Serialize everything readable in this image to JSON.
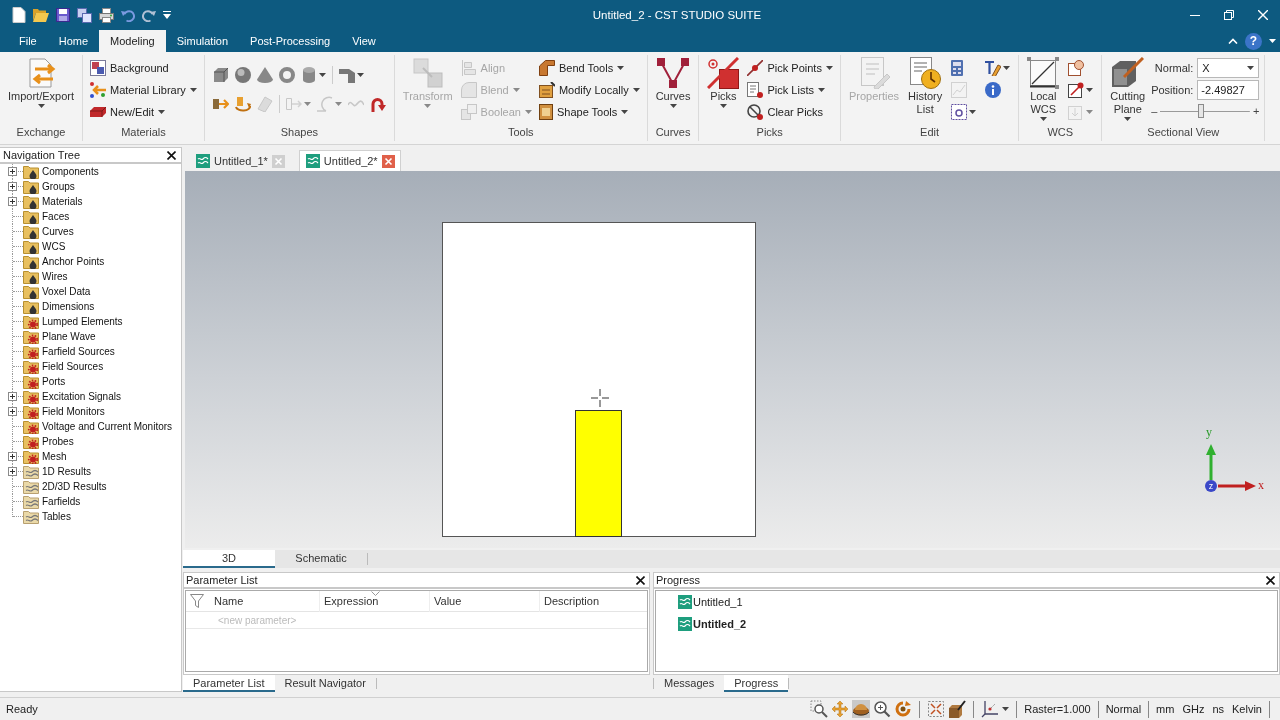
{
  "window": {
    "title": "Untitled_2 - CST STUDIO SUITE"
  },
  "ribbon_tabs": [
    {
      "label": "File",
      "selected": false
    },
    {
      "label": "Home",
      "selected": false
    },
    {
      "label": "Modeling",
      "selected": true
    },
    {
      "label": "Simulation",
      "selected": false
    },
    {
      "label": "Post-Processing",
      "selected": false
    },
    {
      "label": "View",
      "selected": false
    }
  ],
  "help": {
    "label": "?"
  },
  "ribbon_groups": [
    {
      "title": "Exchange",
      "columns": [
        {
          "kind": "large",
          "label": "Import/Export",
          "dropdown": true,
          "disabled": false
        }
      ]
    },
    {
      "title": "Materials",
      "columns": [
        {
          "kind": "stack",
          "items": [
            {
              "kind": "button",
              "label": "Background",
              "dropdown": false,
              "disabled": false
            },
            {
              "kind": "button",
              "label": "Material Library",
              "dropdown": true,
              "disabled": false
            },
            {
              "kind": "button",
              "label": "New/Edit",
              "dropdown": true,
              "disabled": false
            }
          ]
        }
      ]
    },
    {
      "title": "Shapes",
      "columns": [
        {
          "kind": "rows",
          "rows": [
            [
              {
                "kind": "icon",
                "dropdown": false,
                "disabled": false
              },
              {
                "kind": "icon",
                "dropdown": false,
                "disabled": false
              },
              {
                "kind": "icon",
                "dropdown": false,
                "disabled": false
              },
              {
                "kind": "icon",
                "dropdown": false,
                "disabled": false
              },
              {
                "kind": "icon",
                "dropdown": true,
                "disabled": false
              },
              {
                "kind": "separator"
              },
              {
                "kind": "icon",
                "dropdown": true,
                "disabled": false
              }
            ],
            [
              {
                "kind": "icon",
                "dropdown": false,
                "disabled": false
              },
              {
                "kind": "icon",
                "dropdown": false,
                "disabled": false
              },
              {
                "kind": "icon",
                "dropdown": false,
                "disabled": true
              },
              {
                "kind": "separator"
              },
              {
                "kind": "icon",
                "dropdown": true,
                "disabled": true
              },
              {
                "kind": "icon",
                "dropdown": true,
                "disabled": true
              },
              {
                "kind": "icon",
                "dropdown": false,
                "disabled": true
              },
              {
                "kind": "icon",
                "dropdown": false,
                "disabled": false
              }
            ]
          ]
        }
      ]
    },
    {
      "title": "Tools",
      "columns": [
        {
          "kind": "large",
          "label": "Transform",
          "dropdown": true,
          "disabled": true
        },
        {
          "kind": "stack",
          "items": [
            {
              "kind": "button",
              "label": "Align",
              "dropdown": false,
              "disabled": true
            },
            {
              "kind": "button",
              "label": "Blend",
              "dropdown": true,
              "disabled": true
            },
            {
              "kind": "button",
              "label": "Boolean",
              "dropdown": true,
              "disabled": true
            }
          ]
        },
        {
          "kind": "stack",
          "items": [
            {
              "kind": "button",
              "label": "Bend Tools",
              "dropdown": true,
              "disabled": false
            },
            {
              "kind": "button",
              "label": "Modify Locally",
              "dropdown": true,
              "disabled": false
            },
            {
              "kind": "button",
              "label": "Shape Tools",
              "dropdown": true,
              "disabled": false
            }
          ]
        }
      ]
    },
    {
      "title": "Curves",
      "columns": [
        {
          "kind": "large",
          "label": "Curves",
          "dropdown": true,
          "disabled": false
        }
      ]
    },
    {
      "title": "Picks",
      "columns": [
        {
          "kind": "large",
          "label": "Picks",
          "dropdown": true,
          "disabled": false
        },
        {
          "kind": "stack",
          "items": [
            {
              "kind": "button",
              "label": "Pick Points",
              "dropdown": true,
              "disabled": false
            },
            {
              "kind": "button",
              "label": "Pick Lists",
              "dropdown": true,
              "disabled": false
            },
            {
              "kind": "button",
              "label": "Clear Picks",
              "dropdown": false,
              "disabled": false
            }
          ]
        }
      ]
    },
    {
      "title": "Edit",
      "columns": [
        {
          "kind": "large",
          "label": "Properties",
          "dropdown": false,
          "disabled": true
        },
        {
          "kind": "large",
          "label": "History List",
          "dropdown": false,
          "disabled": false
        },
        {
          "kind": "stack",
          "items": [
            {
              "kind": "icon",
              "dropdown": false,
              "disabled": false
            },
            {
              "kind": "icon",
              "dropdown": false,
              "disabled": true
            },
            {
              "kind": "icon",
              "dropdown": true,
              "disabled": false
            }
          ]
        },
        {
          "kind": "stack",
          "items": [
            {
              "kind": "icon",
              "dropdown": true,
              "disabled": false
            },
            {
              "kind": "icon",
              "dropdown": false,
              "disabled": false
            }
          ]
        }
      ]
    },
    {
      "title": "WCS",
      "columns": [
        {
          "kind": "large",
          "label": "Local WCS",
          "dropdown": true,
          "disabled": false
        },
        {
          "kind": "stack",
          "items": [
            {
              "kind": "icon",
              "dropdown": false,
              "disabled": false
            },
            {
              "kind": "icon",
              "dropdown": true,
              "disabled": false
            },
            {
              "kind": "icon",
              "dropdown": true,
              "disabled": true
            }
          ]
        }
      ]
    },
    {
      "title": "Sectional View",
      "columns": [
        {
          "kind": "large",
          "label": "Cutting Plane",
          "dropdown": true,
          "disabled": false
        },
        {
          "kind": "form",
          "fields": [
            {
              "kind": "select",
              "label": "Normal:",
              "value": "X"
            },
            {
              "kind": "text",
              "label": "Position:",
              "value": "-2.49827"
            }
          ],
          "slider": {
            "min_label": "–",
            "max_label": "+",
            "level": 0.45
          }
        }
      ]
    }
  ],
  "navigation_tree": {
    "title": "Navigation Tree",
    "items": [
      {
        "label": "Components",
        "kind": "structure",
        "expandable": true
      },
      {
        "label": "Groups",
        "kind": "structure",
        "expandable": true
      },
      {
        "label": "Materials",
        "kind": "structure",
        "expandable": true
      },
      {
        "label": "Faces",
        "kind": "structure",
        "expandable": false
      },
      {
        "label": "Curves",
        "kind": "structure",
        "expandable": false
      },
      {
        "label": "WCS",
        "kind": "structure",
        "expandable": false
      },
      {
        "label": "Anchor Points",
        "kind": "structure",
        "expandable": false
      },
      {
        "label": "Wires",
        "kind": "structure",
        "expandable": false
      },
      {
        "label": "Voxel Data",
        "kind": "structure",
        "expandable": false
      },
      {
        "label": "Dimensions",
        "kind": "structure",
        "expandable": false
      },
      {
        "label": "Lumped Elements",
        "kind": "solver",
        "expandable": false
      },
      {
        "label": "Plane Wave",
        "kind": "solver",
        "expandable": false
      },
      {
        "label": "Farfield Sources",
        "kind": "solver",
        "expandable": false
      },
      {
        "label": "Field Sources",
        "kind": "solver",
        "expandable": false
      },
      {
        "label": "Ports",
        "kind": "solver",
        "expandable": false
      },
      {
        "label": "Excitation Signals",
        "kind": "solver",
        "expandable": true
      },
      {
        "label": "Field Monitors",
        "kind": "solver",
        "expandable": true
      },
      {
        "label": "Voltage and Current Monitors",
        "kind": "solver",
        "expandable": false
      },
      {
        "label": "Probes",
        "kind": "solver",
        "expandable": false
      },
      {
        "label": "Mesh",
        "kind": "solver",
        "expandable": true
      },
      {
        "label": "1D Results",
        "kind": "result",
        "expandable": true
      },
      {
        "label": "2D/3D Results",
        "kind": "result",
        "expandable": false
      },
      {
        "label": "Farfields",
        "kind": "result",
        "expandable": false
      },
      {
        "label": "Tables",
        "kind": "result",
        "expandable": false
      }
    ]
  },
  "document_tabs": [
    {
      "label": "Untitled_1*",
      "selected": false
    },
    {
      "label": "Untitled_2*",
      "selected": true
    }
  ],
  "axes": {
    "x": "x",
    "y": "y",
    "z": "z"
  },
  "view_tabs": [
    {
      "label": "3D",
      "selected": true
    },
    {
      "label": "Schematic",
      "selected": false
    }
  ],
  "parameter_list": {
    "title": "Parameter List",
    "columns": [
      {
        "label": "Name",
        "sorted": false
      },
      {
        "label": "Expression",
        "sorted": true
      },
      {
        "label": "Value",
        "sorted": false
      },
      {
        "label": "Description",
        "sorted": false
      }
    ],
    "new_row": {
      "placeholder": "<new parameter>"
    },
    "tabs": [
      {
        "label": "Parameter List",
        "selected": true
      },
      {
        "label": "Result Navigator",
        "selected": false
      }
    ]
  },
  "progress": {
    "title": "Progress",
    "items": [
      {
        "label": "Untitled_1",
        "active": false
      },
      {
        "label": "Untitled_2",
        "active": true
      }
    ],
    "tabs": [
      {
        "label": "Messages",
        "selected": false
      },
      {
        "label": "Progress",
        "selected": true
      }
    ]
  },
  "status_bar": {
    "message": "Ready",
    "tools": [
      {
        "kind": "tool",
        "selected": false,
        "dropdown": false
      },
      {
        "kind": "tool",
        "selected": false,
        "dropdown": false
      },
      {
        "kind": "tool",
        "selected": true,
        "dropdown": false
      },
      {
        "kind": "tool",
        "selected": false,
        "dropdown": false
      },
      {
        "kind": "tool",
        "selected": false,
        "dropdown": false
      },
      {
        "kind": "separator"
      },
      {
        "kind": "tool",
        "selected": false,
        "dropdown": false
      },
      {
        "kind": "tool",
        "selected": false,
        "dropdown": false
      },
      {
        "kind": "separator"
      },
      {
        "kind": "tool",
        "selected": false,
        "dropdown": true
      }
    ],
    "raster": "Raster=1.000",
    "mode": "Normal",
    "units": [
      "mm",
      "GHz",
      "ns",
      "Kelvin"
    ]
  }
}
